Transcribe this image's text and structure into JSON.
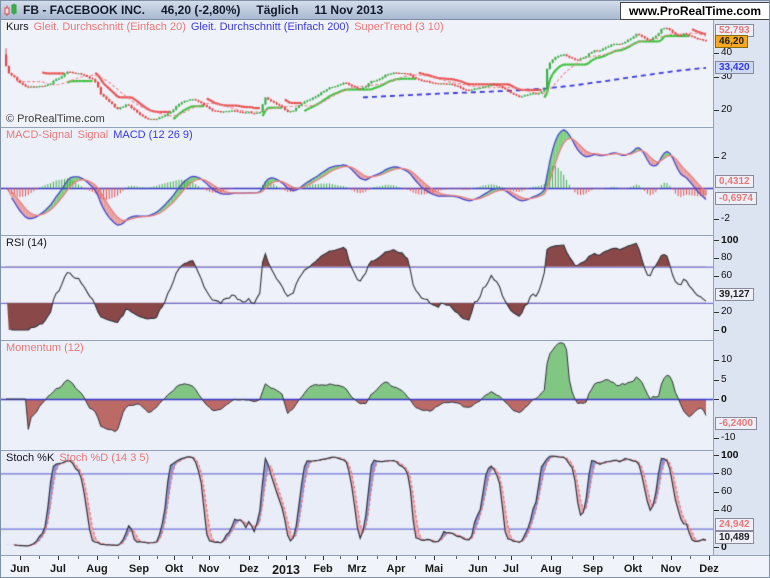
{
  "title_bar": {
    "symbol_title": "FB - FACEBOOK INC.",
    "price": "46,20 (-2,80%)",
    "period": "Täglich",
    "date": "11 Nov 2013",
    "site": "www.ProRealTime.com"
  },
  "watermark": "© ProRealTime.com",
  "colors": {
    "up": "#3fae4a",
    "down": "#e04848",
    "ma20": "#ef8a8a",
    "ma200": "#3a3ad8",
    "st_up": "#3cc13c",
    "st_down": "#e85050",
    "macd_line": "#4848cc",
    "signal_line": "#e88080",
    "fill_pos": "#7ed07e",
    "fill_neg": "#e8a0a0",
    "hist_pos": "#3fae4a",
    "hist_neg": "#e05050",
    "rsi_line": "#32323c",
    "rsi_fill": "#8a4848",
    "mom_line": "#32323c",
    "mom_fill_pos": "#82c684",
    "mom_fill_neg": "#bc6a66",
    "k_line": "#32323c",
    "d_line": "#e87878",
    "kd_fill_up": "#8890d8",
    "kd_fill_dn": "#eaacb6",
    "hline": "#5555cc",
    "zero_line": "#3a3ac8",
    "salmon_text": "#e87878",
    "blue_text": "#3a3ad8",
    "black_text": "#16161e",
    "last_price_bg": "#f6a821",
    "blue_box_bg": "#ccd9f5"
  },
  "x_axis": {
    "months": [
      {
        "label": "Jun",
        "x": 19
      },
      {
        "label": "Jul",
        "x": 57
      },
      {
        "label": "Aug",
        "x": 96
      },
      {
        "label": "Sep",
        "x": 138
      },
      {
        "label": "Okt",
        "x": 173
      },
      {
        "label": "Nov",
        "x": 208
      },
      {
        "label": "Dez",
        "x": 248
      },
      {
        "label": "2013",
        "x": 285,
        "bold": true
      },
      {
        "label": "Feb",
        "x": 322
      },
      {
        "label": "Mrz",
        "x": 356
      },
      {
        "label": "Apr",
        "x": 395
      },
      {
        "label": "Mai",
        "x": 433
      },
      {
        "label": "Jun",
        "x": 477
      },
      {
        "label": "Jul",
        "x": 510
      },
      {
        "label": "Aug",
        "x": 550
      },
      {
        "label": "Sep",
        "x": 592
      },
      {
        "label": "Okt",
        "x": 632
      },
      {
        "label": "Nov",
        "x": 670
      },
      {
        "label": "Dez",
        "x": 708
      }
    ]
  },
  "chart_data": [
    {
      "id": "kurs",
      "type": "candlestick",
      "scale": "log",
      "legend": [
        {
          "text": "Kurs",
          "color": "black"
        },
        {
          "text": "Gleit. Durchschnitt (Einfach 20)",
          "color": "salmon"
        },
        {
          "text": "Gleit. Durchschnitt (Einfach 200)",
          "color": "blue"
        },
        {
          "text": "SuperTrend (3 10)",
          "color": "salmon"
        }
      ],
      "ylim": [
        16.3,
        55.8
      ],
      "yticks": [
        {
          "v": 40,
          "label": "40"
        },
        {
          "v": 30,
          "label": "30"
        },
        {
          "v": 20,
          "label": "20"
        }
      ],
      "axis_boxes": [
        {
          "v": 52.793,
          "label": "52,793",
          "style": "salmon"
        },
        {
          "v": 46.2,
          "label": "46,20",
          "style": "last"
        },
        {
          "v": 33.42,
          "label": "33,420",
          "style": "blue"
        }
      ],
      "series": {
        "close_anchors": [
          [
            0.0,
            34.0
          ],
          [
            0.004,
            31.2
          ],
          [
            0.01,
            30.0
          ],
          [
            0.016,
            28.7
          ],
          [
            0.022,
            27.6
          ],
          [
            0.03,
            26.2
          ],
          [
            0.04,
            26.5
          ],
          [
            0.052,
            26.9
          ],
          [
            0.062,
            27.3
          ],
          [
            0.07,
            28.9
          ],
          [
            0.078,
            30.1
          ],
          [
            0.086,
            31.9
          ],
          [
            0.094,
            31.3
          ],
          [
            0.102,
            31.1
          ],
          [
            0.11,
            30.8
          ],
          [
            0.116,
            29.6
          ],
          [
            0.122,
            28.9
          ],
          [
            0.128,
            27.2
          ],
          [
            0.134,
            24.0
          ],
          [
            0.14,
            23.2
          ],
          [
            0.148,
            21.7
          ],
          [
            0.156,
            20.0
          ],
          [
            0.162,
            20.7
          ],
          [
            0.17,
            21.6
          ],
          [
            0.178,
            20.3
          ],
          [
            0.186,
            19.1
          ],
          [
            0.194,
            18.3
          ],
          [
            0.202,
            18.0
          ],
          [
            0.21,
            17.7
          ],
          [
            0.218,
            18.3
          ],
          [
            0.226,
            19.0
          ],
          [
            0.234,
            19.9
          ],
          [
            0.242,
            21.2
          ],
          [
            0.25,
            22.2
          ],
          [
            0.258,
            22.9
          ],
          [
            0.266,
            22.6
          ],
          [
            0.274,
            21.7
          ],
          [
            0.282,
            20.8
          ],
          [
            0.292,
            19.9
          ],
          [
            0.302,
            19.4
          ],
          [
            0.312,
            19.8
          ],
          [
            0.322,
            19.9
          ],
          [
            0.332,
            19.2
          ],
          [
            0.342,
            19.5
          ],
          [
            0.352,
            19.2
          ],
          [
            0.358,
            19.5
          ],
          [
            0.364,
            23.2
          ],
          [
            0.372,
            22.4
          ],
          [
            0.38,
            21.7
          ],
          [
            0.388,
            20.6
          ],
          [
            0.396,
            19.5
          ],
          [
            0.404,
            19.9
          ],
          [
            0.414,
            21.5
          ],
          [
            0.424,
            22.3
          ],
          [
            0.434,
            23.5
          ],
          [
            0.444,
            24.7
          ],
          [
            0.454,
            26.0
          ],
          [
            0.464,
            26.9
          ],
          [
            0.474,
            27.8
          ],
          [
            0.482,
            27.2
          ],
          [
            0.49,
            26.4
          ],
          [
            0.498,
            25.9
          ],
          [
            0.506,
            26.6
          ],
          [
            0.514,
            28.2
          ],
          [
            0.524,
            29.1
          ],
          [
            0.534,
            30.5
          ],
          [
            0.544,
            31.2
          ],
          [
            0.554,
            31.6
          ],
          [
            0.564,
            31.2
          ],
          [
            0.572,
            29.8
          ],
          [
            0.582,
            28.8
          ],
          [
            0.592,
            28.4
          ],
          [
            0.602,
            27.4
          ],
          [
            0.612,
            27.8
          ],
          [
            0.622,
            27.5
          ],
          [
            0.632,
            26.8
          ],
          [
            0.642,
            26.0
          ],
          [
            0.652,
            25.3
          ],
          [
            0.662,
            25.9
          ],
          [
            0.672,
            26.6
          ],
          [
            0.682,
            27.2
          ],
          [
            0.692,
            26.7
          ],
          [
            0.7,
            26.3
          ],
          [
            0.708,
            25.0
          ],
          [
            0.716,
            23.9
          ],
          [
            0.724,
            23.3
          ],
          [
            0.732,
            24.2
          ],
          [
            0.74,
            24.5
          ],
          [
            0.748,
            24.1
          ],
          [
            0.754,
            25.1
          ],
          [
            0.758,
            26.1
          ],
          [
            0.762,
            34.4
          ],
          [
            0.768,
            36.9
          ],
          [
            0.774,
            38.0
          ],
          [
            0.78,
            38.7
          ],
          [
            0.786,
            39.2
          ],
          [
            0.792,
            38.3
          ],
          [
            0.798,
            37.1
          ],
          [
            0.804,
            36.7
          ],
          [
            0.81,
            37.5
          ],
          [
            0.816,
            38.3
          ],
          [
            0.822,
            40.6
          ],
          [
            0.828,
            41.3
          ],
          [
            0.834,
            40.6
          ],
          [
            0.84,
            41.9
          ],
          [
            0.846,
            43.3
          ],
          [
            0.852,
            44.3
          ],
          [
            0.858,
            45.1
          ],
          [
            0.864,
            44.2
          ],
          [
            0.87,
            45.3
          ],
          [
            0.876,
            47.2
          ],
          [
            0.882,
            48.9
          ],
          [
            0.888,
            50.4
          ],
          [
            0.894,
            49.0
          ],
          [
            0.9,
            47.1
          ],
          [
            0.906,
            46.8
          ],
          [
            0.912,
            49.1
          ],
          [
            0.918,
            50.8
          ],
          [
            0.924,
            54.1
          ],
          [
            0.93,
            53.8
          ],
          [
            0.936,
            52.3
          ],
          [
            0.942,
            50.1
          ],
          [
            0.948,
            49.4
          ],
          [
            0.954,
            50.2
          ],
          [
            0.962,
            49.3
          ],
          [
            0.97,
            48.3
          ],
          [
            0.978,
            46.9
          ],
          [
            0.985,
            46.2
          ]
        ],
        "ma200_anchors": [
          [
            0.5,
            23.3
          ],
          [
            0.56,
            23.9
          ],
          [
            0.62,
            24.5
          ],
          [
            0.68,
            25.0
          ],
          [
            0.72,
            25.4
          ],
          [
            0.76,
            26.0
          ],
          [
            0.8,
            27.0
          ],
          [
            0.84,
            28.3
          ],
          [
            0.88,
            29.8
          ],
          [
            0.92,
            31.3
          ],
          [
            0.95,
            32.4
          ],
          [
            0.985,
            33.42
          ]
        ]
      }
    },
    {
      "id": "macd",
      "type": "macd",
      "derived_from": "kurs.close",
      "params": [
        12,
        26,
        9
      ],
      "legend": [
        {
          "text": "MACD-Signal",
          "color": "salmon"
        },
        {
          "text": "Signal",
          "color": "salmon"
        },
        {
          "text": "MACD (12 26 9)",
          "color": "blue"
        }
      ],
      "yticks": [
        {
          "v": 2,
          "label": "2"
        },
        {
          "v": -2,
          "label": "-2"
        }
      ],
      "zero_line": true,
      "axis_boxes": [
        {
          "v": 0.4312,
          "label": "0,4312",
          "style": "salmon"
        },
        {
          "v": -0.6974,
          "label": "-0,6974",
          "style": "salmon"
        }
      ]
    },
    {
      "id": "rsi",
      "type": "line",
      "derived_from": "kurs.close",
      "params": [
        14
      ],
      "legend": [
        {
          "text": "RSI (14)",
          "color": "black"
        }
      ],
      "ylim": [
        0,
        100
      ],
      "hlines": [
        70,
        30
      ],
      "yticks": [
        {
          "v": 100,
          "label": "100",
          "bold": true
        },
        {
          "v": 80,
          "label": "80"
        },
        {
          "v": 60,
          "label": "60"
        },
        {
          "v": 20,
          "label": "20"
        },
        {
          "v": 0,
          "label": "0",
          "bold": true
        }
      ],
      "axis_boxes": [
        {
          "v": 39.127,
          "label": "39,127",
          "style": "plain"
        }
      ]
    },
    {
      "id": "momentum",
      "type": "area-line",
      "derived_from": "kurs.close",
      "params": [
        12
      ],
      "legend": [
        {
          "text": "Momentum (12)",
          "color": "salmon"
        }
      ],
      "zero_line": true,
      "yticks": [
        {
          "v": 10,
          "label": "10"
        },
        {
          "v": 5,
          "label": "5"
        },
        {
          "v": 0,
          "label": "0",
          "bold": true
        },
        {
          "v": -10,
          "label": "-10"
        }
      ],
      "axis_boxes": [
        {
          "v": -6.24,
          "label": "-6,2400",
          "style": "salmon"
        }
      ]
    },
    {
      "id": "stoch",
      "type": "stochastic",
      "derived_from": "kurs",
      "params": [
        14,
        3,
        5
      ],
      "legend": [
        {
          "text": "Stoch %K",
          "color": "black"
        },
        {
          "text": "Stoch %D (14 3 5)",
          "color": "salmon"
        }
      ],
      "ylim": [
        0,
        100
      ],
      "hlines": [
        80,
        20
      ],
      "yticks": [
        {
          "v": 100,
          "label": "100",
          "bold": true
        },
        {
          "v": 80,
          "label": "80"
        },
        {
          "v": 60,
          "label": "60"
        },
        {
          "v": 40,
          "label": "40"
        },
        {
          "v": 0,
          "label": "0",
          "bold": true
        }
      ],
      "axis_boxes": [
        {
          "v": 24.942,
          "label": "24,942",
          "style": "salmon"
        },
        {
          "v": 10.489,
          "label": "10,489",
          "style": "plain"
        }
      ]
    }
  ]
}
